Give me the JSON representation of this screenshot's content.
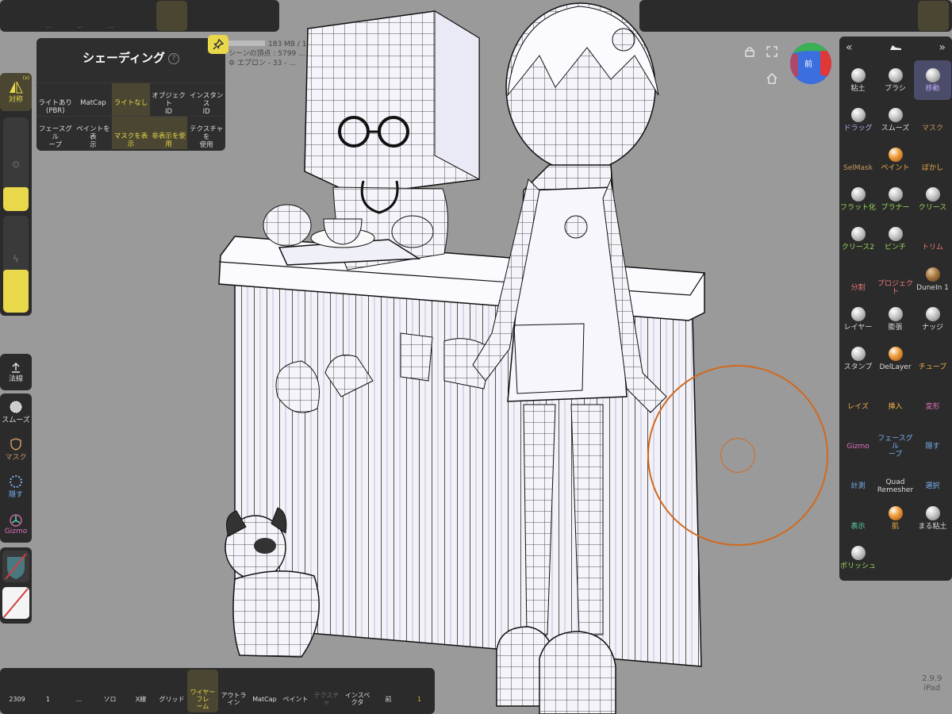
{
  "top_left_toolbar": {
    "buttons": [
      {
        "name": "scene-shoe-icon",
        "dots": ""
      },
      {
        "name": "folder-icon",
        "dots": "..."
      },
      {
        "name": "share-nodes-icon",
        "dots": "..."
      },
      {
        "name": "topology-icon",
        "dots": "..."
      },
      {
        "name": "texture-sphere-icon",
        "dots": ""
      },
      {
        "name": "sun-icon",
        "dots": ""
      },
      {
        "name": "gear-wheel-icon",
        "dots": ""
      },
      {
        "name": "image-icon",
        "dots": ""
      },
      {
        "name": "video-camera-icon",
        "dots": ""
      }
    ]
  },
  "top_right_toolbar": {
    "buttons": [
      "shoe-brush-icon",
      "matcap-ball-icon",
      "filter-icon",
      "pen-icon",
      "symmetry-icon",
      "flask-icon",
      "layers-icon",
      "settings-icon",
      "bug-icon",
      "tools-icon"
    ]
  },
  "shading_popup": {
    "title": "シェーディング",
    "help": "?",
    "row1": [
      "ライトあり\n(PBR)",
      "MatCap",
      "ライトなし",
      "オブジェクト\nID",
      "インスタンス\nID"
    ],
    "row2": [
      "フェースグル\nープ",
      "ペイントを表\n示",
      "マスクを表示",
      "非表示を使用",
      "テクスチャを\n使用"
    ]
  },
  "scene_info": {
    "memory": "183 MB / 1",
    "vertices": "シーンの頂点 : 5799 ...",
    "object": "エプロン - 33 - ..."
  },
  "left_panel": {
    "symmetry_label": "対称",
    "symmetry_badge": "(x)",
    "normal_label": "法線",
    "tools": [
      "スムーズ",
      "マスク",
      "隠す",
      "Gizmo"
    ]
  },
  "nav_cube": {
    "label": "前"
  },
  "right_panel": {
    "tools": [
      {
        "label": "粘土",
        "color": "#dddddd",
        "kind": "ball"
      },
      {
        "label": "ブラシ",
        "color": "#dddddd",
        "kind": "ball"
      },
      {
        "label": "移動",
        "color": "#b8a8f0",
        "kind": "ball"
      },
      {
        "label": "ドラッグ",
        "color": "#b8a8f0",
        "kind": "ball"
      },
      {
        "label": "スムーズ",
        "color": "#dddddd",
        "kind": "ball"
      },
      {
        "label": "マスク",
        "color": "#c89a60",
        "kind": "ic"
      },
      {
        "label": "SelMask",
        "color": "#c89a60",
        "kind": "ic"
      },
      {
        "label": "ペイント",
        "color": "#f0b048",
        "kind": "orange"
      },
      {
        "label": "ぼかし",
        "color": "#f0b048",
        "kind": "ic"
      },
      {
        "label": "フラット化",
        "color": "#9ad858",
        "kind": "ball"
      },
      {
        "label": "プラナー",
        "color": "#9ad858",
        "kind": "ball"
      },
      {
        "label": "クリース",
        "color": "#9ad858",
        "kind": "ball"
      },
      {
        "label": "クリース2",
        "color": "#9ad858",
        "kind": "ball"
      },
      {
        "label": "ピンチ",
        "color": "#9ad858",
        "kind": "ball"
      },
      {
        "label": "トリム",
        "color": "#f07878",
        "kind": "ic"
      },
      {
        "label": "分割",
        "color": "#f07878",
        "kind": "ic"
      },
      {
        "label": "プロジェクト",
        "color": "#f07878",
        "kind": "ic"
      },
      {
        "label": "DuneIn 1",
        "color": "#dddddd",
        "kind": "brown"
      },
      {
        "label": "レイヤー",
        "color": "#dddddd",
        "kind": "ball"
      },
      {
        "label": "膨張",
        "color": "#dddddd",
        "kind": "ball"
      },
      {
        "label": "ナッジ",
        "color": "#dddddd",
        "kind": "ball"
      },
      {
        "label": "スタンプ",
        "color": "#dddddd",
        "kind": "ball"
      },
      {
        "label": "DelLayer",
        "color": "#dddddd",
        "kind": "orange"
      },
      {
        "label": "チューブ",
        "color": "#f0b048",
        "kind": "ic"
      },
      {
        "label": "レイズ",
        "color": "#f0b048",
        "kind": "ic"
      },
      {
        "label": "挿入",
        "color": "#f0b048",
        "kind": "ic"
      },
      {
        "label": "変形",
        "color": "#e070c0",
        "kind": "ic"
      },
      {
        "label": "Gizmo",
        "color": "#e070c0",
        "kind": "ic"
      },
      {
        "label": "フェースグル\nープ",
        "color": "#7ab0f0",
        "kind": "ic"
      },
      {
        "label": "隠す",
        "color": "#7ab0f0",
        "kind": "ic"
      },
      {
        "label": "計測",
        "color": "#7ab0f0",
        "kind": "ic"
      },
      {
        "label": "Quad\nRemesher",
        "color": "#dddddd",
        "kind": "ic"
      },
      {
        "label": "選択",
        "color": "#7ab0f0",
        "kind": "ic"
      },
      {
        "label": "表示",
        "color": "#58d8b0",
        "kind": "ic"
      },
      {
        "label": "肌",
        "color": "#f0b048",
        "kind": "orange"
      },
      {
        "label": "まる粘土",
        "color": "#dddddd",
        "kind": "ball"
      },
      {
        "label": "ポリッシュ",
        "color": "#9ad858",
        "kind": "ball"
      }
    ]
  },
  "bottom_toolbar": {
    "buttons": [
      {
        "name": "undo",
        "label": "2309"
      },
      {
        "name": "redo",
        "label": "1"
      },
      {
        "name": "more",
        "label": "..."
      },
      {
        "name": "solo",
        "label": "ソロ"
      },
      {
        "name": "xray",
        "label": "X線"
      },
      {
        "name": "grid",
        "label": "グリッド"
      },
      {
        "name": "wireframe",
        "label": "ワイヤーフレ\nーム"
      },
      {
        "name": "outline",
        "label": "アウトライン"
      },
      {
        "name": "matcap",
        "label": "MatCap"
      },
      {
        "name": "paint",
        "label": "ペイント"
      },
      {
        "name": "texture",
        "label": "テクスチャ"
      },
      {
        "name": "inspector",
        "label": "インスペクタ"
      },
      {
        "name": "front",
        "label": "前"
      },
      {
        "name": "warning",
        "label": "1"
      }
    ]
  },
  "version": {
    "number": "2.9.9",
    "device": "iPad"
  },
  "colors": {
    "accent": "#e8d84a",
    "panel": "#2b2b2b",
    "viewport": "#9a9a9a",
    "brush_ring": "#d2691e"
  }
}
